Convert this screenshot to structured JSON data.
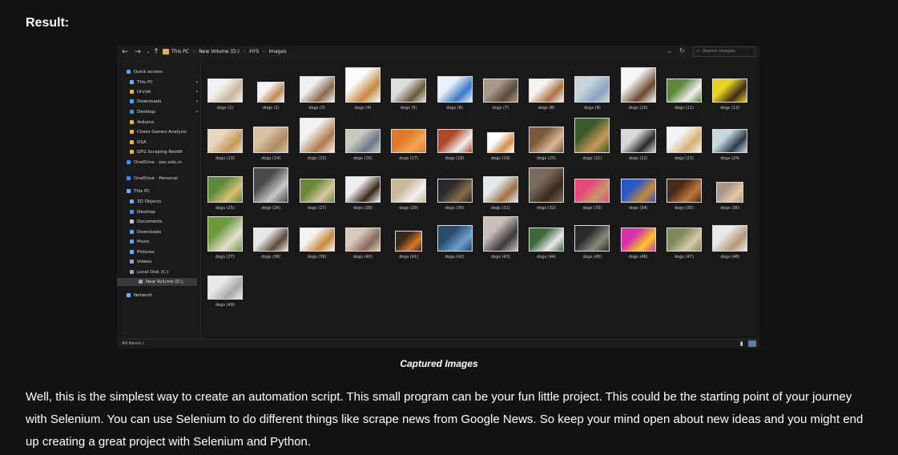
{
  "heading": "Result:",
  "explorer": {
    "breadcrumb": [
      "This PC",
      "New Volume (D:)",
      "HYS",
      "Images"
    ],
    "search_placeholder": "Search Images",
    "status": "49 items",
    "sidebar": [
      {
        "label": "Quick access",
        "icon": "star-icon",
        "color": "#4aa3ff",
        "level": 1,
        "pinned": false
      },
      {
        "label": "This PC",
        "icon": "computer-icon",
        "color": "#6ab0ff",
        "level": 2,
        "pinned": true
      },
      {
        "label": "Urvish",
        "icon": "folder-icon",
        "color": "#e6b43c",
        "level": 2,
        "pinned": true
      },
      {
        "label": "Downloads",
        "icon": "download-icon",
        "color": "#5aa0ff",
        "level": 2,
        "pinned": true
      },
      {
        "label": "Desktop",
        "icon": "desktop-icon",
        "color": "#4a90e0",
        "level": 2,
        "pinned": true
      },
      {
        "label": "Arduino",
        "icon": "folder-icon",
        "color": "#e6b43c",
        "level": 2,
        "pinned": false
      },
      {
        "label": "Chess Games Analysis",
        "icon": "folder-icon",
        "color": "#e6b43c",
        "level": 2,
        "pinned": false
      },
      {
        "label": "DSA",
        "icon": "folder-icon",
        "color": "#e6b43c",
        "level": 2,
        "pinned": false
      },
      {
        "label": "GFG Scraping Reddit",
        "icon": "folder-icon",
        "color": "#e6b43c",
        "level": 2,
        "pinned": false
      },
      {
        "label": "OneDrive - pec.edu.in",
        "icon": "cloud-icon",
        "color": "#3f8ef0",
        "level": 1,
        "pinned": false
      },
      {
        "label": "OneDrive - Personal",
        "icon": "cloud-icon",
        "color": "#3f8ef0",
        "level": 1,
        "pinned": false
      },
      {
        "label": "This PC",
        "icon": "computer-icon",
        "color": "#6ab0ff",
        "level": 1,
        "pinned": false
      },
      {
        "label": "3D Objects",
        "icon": "cube-icon",
        "color": "#6ab0ff",
        "level": 2,
        "pinned": false
      },
      {
        "label": "Desktop",
        "icon": "desktop-icon",
        "color": "#4a90e0",
        "level": 2,
        "pinned": false
      },
      {
        "label": "Documents",
        "icon": "document-icon",
        "color": "#c8c8c8",
        "level": 2,
        "pinned": false
      },
      {
        "label": "Downloads",
        "icon": "download-icon",
        "color": "#5aa0ff",
        "level": 2,
        "pinned": false
      },
      {
        "label": "Music",
        "icon": "music-icon",
        "color": "#5aa0ff",
        "level": 2,
        "pinned": false
      },
      {
        "label": "Pictures",
        "icon": "picture-icon",
        "color": "#6ab0ff",
        "level": 2,
        "pinned": false
      },
      {
        "label": "Videos",
        "icon": "video-icon",
        "color": "#a0a0c8",
        "level": 2,
        "pinned": false
      },
      {
        "label": "Local Disk (C:)",
        "icon": "drive-icon",
        "color": "#9aa6b4",
        "level": 2,
        "pinned": false
      },
      {
        "label": "New Volume (D:)",
        "icon": "drive-icon",
        "color": "#9aa6b4",
        "level": 2,
        "pinned": false,
        "selected": true
      },
      {
        "label": "Network",
        "icon": "network-icon",
        "color": "#6ab0ff",
        "level": 1,
        "pinned": false
      }
    ],
    "files": [
      {
        "name": "dogs (1)",
        "colors": [
          "#f2f2f2",
          "#c9b49a"
        ]
      },
      {
        "name": "dogs (2)",
        "colors": [
          "#f3f3f3",
          "#c08850"
        ]
      },
      {
        "name": "dogs (3)",
        "colors": [
          "#f0f0f0",
          "#8a6a4a"
        ]
      },
      {
        "name": "dogs (4)",
        "colors": [
          "#fafafa",
          "#c88a40"
        ]
      },
      {
        "name": "dogs (5)",
        "colors": [
          "#dedede",
          "#6a5a3a"
        ]
      },
      {
        "name": "dogs (6)",
        "colors": [
          "#e8f0f8",
          "#3a78c8"
        ]
      },
      {
        "name": "dogs (7)",
        "colors": [
          "#a89888",
          "#5a4a3a"
        ]
      },
      {
        "name": "dogs (8)",
        "colors": [
          "#f4f4f4",
          "#b07040"
        ]
      },
      {
        "name": "dogs (9)",
        "colors": [
          "#c8d4dc",
          "#8aa4c0"
        ]
      },
      {
        "name": "dogs (10)",
        "colors": [
          "#f6f6f6",
          "#6a4a2a"
        ]
      },
      {
        "name": "dogs (11)",
        "colors": [
          "#5a8a3a",
          "#f0f0f0"
        ]
      },
      {
        "name": "dogs (12)",
        "colors": [
          "#e8d020",
          "#3a2a1a"
        ]
      },
      {
        "name": "dogs (13)",
        "colors": [
          "#e8d8c0",
          "#c89858"
        ]
      },
      {
        "name": "dogs (14)",
        "colors": [
          "#d8c0a0",
          "#b08860"
        ]
      },
      {
        "name": "dogs (15)",
        "colors": [
          "#f2f2f2",
          "#b07a48"
        ]
      },
      {
        "name": "dogs (16)",
        "colors": [
          "#c8c8c0",
          "#6a7a8a"
        ]
      },
      {
        "name": "dogs (17)",
        "colors": [
          "#e07828",
          "#f0a858"
        ]
      },
      {
        "name": "dogs (18)",
        "colors": [
          "#b04828",
          "#f0f0f0"
        ]
      },
      {
        "name": "dogs (19)",
        "colors": [
          "#ffffff",
          "#d89048"
        ]
      },
      {
        "name": "dogs (20)",
        "colors": [
          "#7a5838",
          "#d8b898"
        ]
      },
      {
        "name": "dogs (21)",
        "colors": [
          "#3a5a2a",
          "#c89858"
        ]
      },
      {
        "name": "dogs (22)",
        "colors": [
          "#d8d8d8",
          "#2a2a2a"
        ]
      },
      {
        "name": "dogs (23)",
        "colors": [
          "#f4f4f4",
          "#d8b070"
        ]
      },
      {
        "name": "dogs (24)",
        "colors": [
          "#c8d8e0",
          "#2a3a4a"
        ]
      },
      {
        "name": "dogs (25)",
        "colors": [
          "#5a8a3a",
          "#d8c070"
        ]
      },
      {
        "name": "dogs (26)",
        "colors": [
          "#4a4a4a",
          "#c8c8c8"
        ]
      },
      {
        "name": "dogs (27)",
        "colors": [
          "#6a8a3a",
          "#d8c8a0"
        ]
      },
      {
        "name": "dogs (28)",
        "colors": [
          "#f0f0f0",
          "#3a2a1a"
        ]
      },
      {
        "name": "dogs (29)",
        "colors": [
          "#c8b898",
          "#f0f0f0"
        ]
      },
      {
        "name": "dogs (30)",
        "colors": [
          "#2a2a2a",
          "#8a6a4a"
        ]
      },
      {
        "name": "dogs (31)",
        "colors": [
          "#e0e8f0",
          "#a07040"
        ]
      },
      {
        "name": "dogs (32)",
        "colors": [
          "#7a6a5a",
          "#3a2a1a"
        ]
      },
      {
        "name": "dogs (33)",
        "colors": [
          "#e84878",
          "#c89868"
        ]
      },
      {
        "name": "dogs (34)",
        "colors": [
          "#2858c8",
          "#c88838"
        ]
      },
      {
        "name": "dogs (35)",
        "colors": [
          "#4a2a1a",
          "#c07838"
        ]
      },
      {
        "name": "dogs (36)",
        "colors": [
          "#a89888",
          "#e8c8a0"
        ]
      },
      {
        "name": "dogs (37)",
        "colors": [
          "#6a9a3a",
          "#e8e0d0"
        ]
      },
      {
        "name": "dogs (38)",
        "colors": [
          "#e8e8e8",
          "#5a4a3a"
        ]
      },
      {
        "name": "dogs (39)",
        "colors": [
          "#f4f4f4",
          "#c88838"
        ]
      },
      {
        "name": "dogs (40)",
        "colors": [
          "#d8c8b8",
          "#8a6a5a"
        ]
      },
      {
        "name": "dogs (41)",
        "colors": [
          "#3a2a1a",
          "#d87828"
        ]
      },
      {
        "name": "dogs (42)",
        "colors": [
          "#2a4a6a",
          "#6aa0d0"
        ]
      },
      {
        "name": "dogs (43)",
        "colors": [
          "#c8c0b8",
          "#3a3a3a"
        ]
      },
      {
        "name": "dogs (44)",
        "colors": [
          "#3a6a3a",
          "#e8e8e8"
        ]
      },
      {
        "name": "dogs (45)",
        "colors": [
          "#2a2a2a",
          "#8a8a7a"
        ]
      },
      {
        "name": "dogs (46)",
        "colors": [
          "#d830a8",
          "#f8c820"
        ]
      },
      {
        "name": "dogs (47)",
        "colors": [
          "#7a8a5a",
          "#d8c8a8"
        ]
      },
      {
        "name": "dogs (48)",
        "colors": [
          "#e8e8e8",
          "#b89878"
        ]
      },
      {
        "name": "dogs (49)",
        "colors": [
          "#e8e8e8",
          "#a8a8a8"
        ]
      }
    ]
  },
  "caption": "Captured Images",
  "paragraph": "Well, this is the simplest way to create an automation script. This small program can be your fun little project. This could be the starting point of your journey with Selenium. You can use Selenium to do different things like scrape news from Google News. So keep your mind open about new ideas and you might end up creating a great project with Selenium and Python."
}
